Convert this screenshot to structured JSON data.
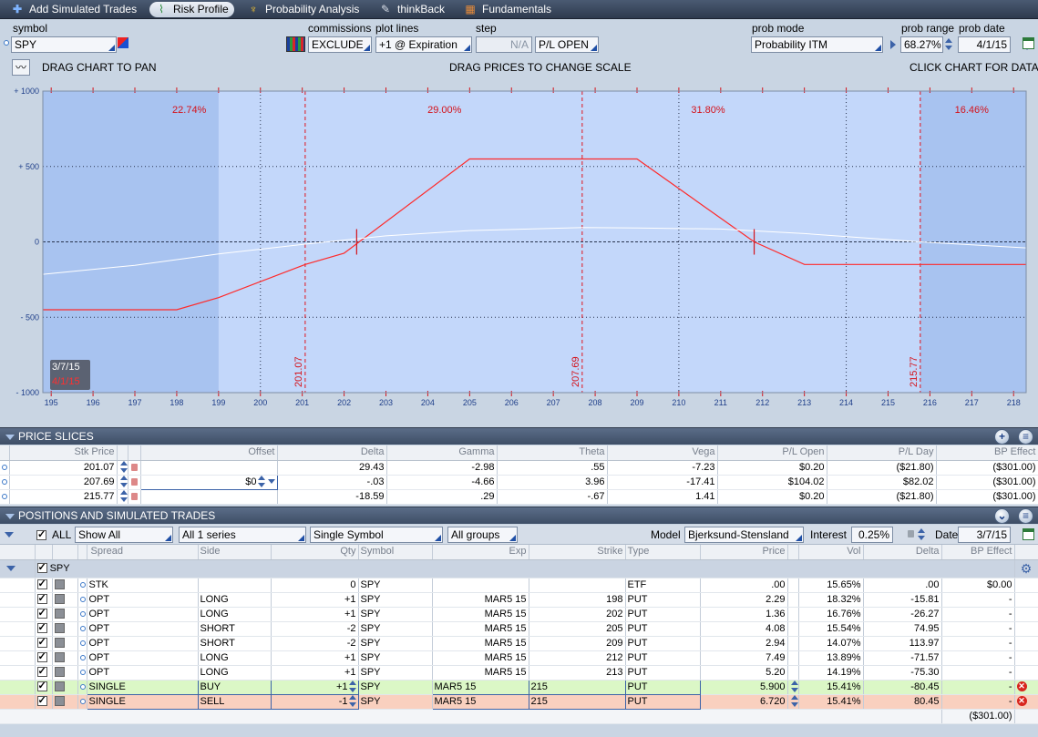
{
  "toolbar": {
    "add_simulated": "Add Simulated Trades",
    "risk_profile": "Risk Profile",
    "probability": "Probability Analysis",
    "thinkback": "thinkBack",
    "fundamentals": "Fundamentals"
  },
  "controls": {
    "symbol_label": "symbol",
    "symbol": "SPY",
    "commissions_label": "commissions",
    "commissions": "EXCLUDE",
    "plot_lines_label": "plot lines",
    "plot_lines": "+1 @ Expiration",
    "step_label": "step",
    "step": "N/A",
    "pl_mode": "P/L OPEN",
    "prob_mode_label": "prob mode",
    "prob_mode": "Probability ITM",
    "prob_range_label": "prob range",
    "prob_range": "68.27%",
    "prob_date_label": "prob date",
    "prob_date": "4/1/15"
  },
  "hints": {
    "pan": "DRAG CHART TO PAN",
    "scale": "DRAG PRICES TO CHANGE SCALE",
    "data": "CLICK CHART FOR DATA"
  },
  "chart_data": {
    "type": "line",
    "xlim": [
      194.8,
      218.3
    ],
    "ylim": [
      -1000,
      1000
    ],
    "x_ticks": [
      "195",
      "196",
      "197",
      "198",
      "199",
      "200",
      "201",
      "202",
      "203",
      "204",
      "205",
      "206",
      "207",
      "208",
      "209",
      "210",
      "211",
      "212",
      "213",
      "214",
      "215",
      "216",
      "217",
      "218"
    ],
    "y_ticks": [
      "+ 1000",
      "+ 500",
      "0",
      "- 500",
      "- 1000"
    ],
    "prob_band": [
      199.0,
      215.77
    ],
    "breakevens": [
      201.07,
      207.69,
      215.77
    ],
    "breakeven_labels": [
      "201.07",
      "207.69",
      "215.77"
    ],
    "region_probs": [
      {
        "x": 198.3,
        "label": "22.74%"
      },
      {
        "x": 204.4,
        "label": "29.00%"
      },
      {
        "x": 210.7,
        "label": "31.80%"
      },
      {
        "x": 217.0,
        "label": "16.46%"
      }
    ],
    "dotted_x": [
      200,
      210,
      214
    ],
    "series": [
      {
        "color": "#ff2a2a",
        "points": [
          [
            194.8,
            -450
          ],
          [
            198,
            -450
          ],
          [
            199,
            -370
          ],
          [
            201.07,
            -150
          ],
          [
            202,
            -75
          ],
          [
            205,
            550
          ],
          [
            209,
            550
          ],
          [
            211.8,
            0
          ],
          [
            213,
            -150
          ],
          [
            218.3,
            -150
          ]
        ]
      },
      {
        "color": "#ffffff",
        "points": [
          [
            194.8,
            -215
          ],
          [
            197,
            -155
          ],
          [
            199,
            -80
          ],
          [
            201.07,
            -15
          ],
          [
            203,
            40
          ],
          [
            205,
            75
          ],
          [
            207.69,
            95
          ],
          [
            209,
            92
          ],
          [
            211,
            85
          ],
          [
            213,
            55
          ],
          [
            215.77,
            0
          ],
          [
            218.3,
            -40
          ]
        ]
      }
    ],
    "dates": [
      "3/7/15",
      "4/1/15"
    ]
  },
  "slices": {
    "title": "PRICE SLICES",
    "columns": [
      "Stk Price",
      "Offset",
      "Delta",
      "Gamma",
      "Theta",
      "Vega",
      "P/L Open",
      "P/L Day",
      "BP Effect"
    ],
    "rows": [
      [
        "201.07",
        "",
        "29.43",
        "-2.98",
        ".55",
        "-7.23",
        "$0.20",
        "($21.80)",
        "($301.00)"
      ],
      [
        "207.69",
        "$0",
        "-.03",
        "-4.66",
        "3.96",
        "-17.41",
        "$104.02",
        "$82.02",
        "($301.00)"
      ],
      [
        "215.77",
        "",
        "-18.59",
        ".29",
        "-.67",
        "1.41",
        "$0.20",
        "($21.80)",
        "($301.00)"
      ]
    ]
  },
  "positions": {
    "title": "POSITIONS AND SIMULATED TRADES",
    "all": "ALL",
    "show": "Show All",
    "series": "All 1 series",
    "single_symbol": "Single Symbol",
    "groups": "All groups",
    "model_label": "Model",
    "model": "Bjerksund-Stensland",
    "interest_label": "Interest",
    "interest": "0.25%",
    "date_label": "Date",
    "date": "3/7/15",
    "columns": [
      "Spread",
      "Side",
      "Qty",
      "Symbol",
      "Exp",
      "Strike",
      "Type",
      "Price",
      "Vol",
      "Delta",
      "BP Effect"
    ],
    "group": "SPY",
    "rows": [
      [
        "STK",
        "",
        "0",
        "SPY",
        "",
        "",
        "ETF",
        ".00",
        "15.65%",
        ".00",
        "$0.00"
      ],
      [
        "OPT",
        "LONG",
        "+1",
        "SPY",
        "MAR5 15",
        "198",
        "PUT",
        "2.29",
        "18.32%",
        "-15.81",
        "-"
      ],
      [
        "OPT",
        "LONG",
        "+1",
        "SPY",
        "MAR5 15",
        "202",
        "PUT",
        "1.36",
        "16.76%",
        "-26.27",
        "-"
      ],
      [
        "OPT",
        "SHORT",
        "-2",
        "SPY",
        "MAR5 15",
        "205",
        "PUT",
        "4.08",
        "15.54%",
        "74.95",
        "-"
      ],
      [
        "OPT",
        "SHORT",
        "-2",
        "SPY",
        "MAR5 15",
        "209",
        "PUT",
        "2.94",
        "14.07%",
        "113.97",
        "-"
      ],
      [
        "OPT",
        "LONG",
        "+1",
        "SPY",
        "MAR5 15",
        "212",
        "PUT",
        "7.49",
        "13.89%",
        "-71.57",
        "-"
      ],
      [
        "OPT",
        "LONG",
        "+1",
        "SPY",
        "MAR5 15",
        "213",
        "PUT",
        "5.20",
        "14.19%",
        "-75.30",
        "-"
      ],
      [
        "SINGLE",
        "BUY",
        "+1",
        "SPY",
        "MAR5 15",
        "215",
        "PUT",
        "5.900",
        "15.41%",
        "-80.45",
        "-"
      ],
      [
        "SINGLE",
        "SELL",
        "-1",
        "SPY",
        "MAR5 15",
        "215",
        "PUT",
        "6.720",
        "15.41%",
        "80.45",
        "-"
      ]
    ],
    "total": "($301.00)"
  }
}
